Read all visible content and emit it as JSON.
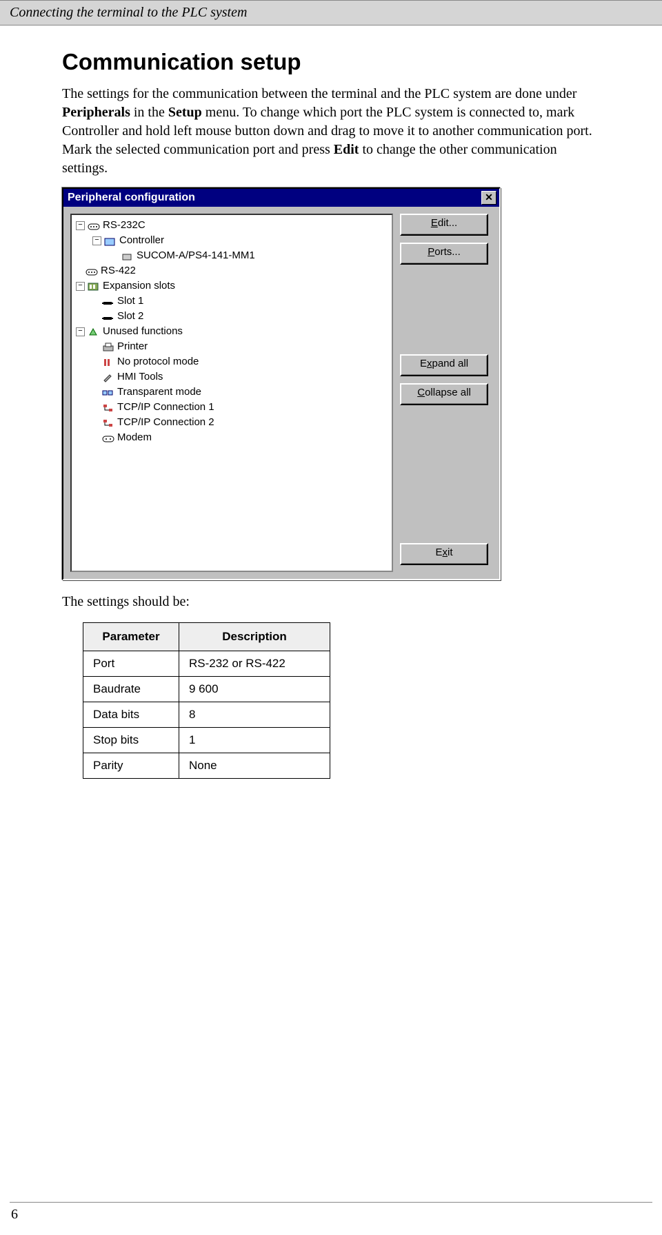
{
  "header": {
    "title": "Connecting the terminal to the PLC system"
  },
  "main": {
    "heading": "Communication setup",
    "para1_a": "The settings for the communication between the terminal and the PLC system are done under ",
    "para1_b": "Peripherals",
    "para1_c": " in the ",
    "para1_d": "Setup",
    "para1_e": " menu. To change which port the PLC system is connected to, mark Controller and hold left mouse button down and drag to move it to another communication port. Mark the selected communication port and press ",
    "para1_f": "Edit",
    "para1_g": " to change the other communication settings.",
    "after_dialog": "The settings should be:"
  },
  "dialog": {
    "title": "Peripheral configuration",
    "buttons": {
      "edit": "Edit...",
      "ports": "Ports...",
      "expand": "Expand all",
      "collapse": "Collapse all",
      "exit": "Exit"
    },
    "tree": {
      "rs232c": "RS-232C",
      "controller": "Controller",
      "driver": "SUCOM-A/PS4-141-MM1",
      "rs422": "RS-422",
      "expansion": "Expansion slots",
      "slot1": "Slot 1",
      "slot2": "Slot 2",
      "unused": "Unused functions",
      "printer": "Printer",
      "noproto": "No protocol mode",
      "hmi": "HMI Tools",
      "transparent": "Transparent mode",
      "tcpip1": "TCP/IP Connection 1",
      "tcpip2": "TCP/IP Connection 2",
      "modem": "Modem"
    }
  },
  "table": {
    "h1": "Parameter",
    "h2": "Description",
    "rows": [
      {
        "p": "Port",
        "d": "RS-232 or RS-422"
      },
      {
        "p": "Baudrate",
        "d": "9 600"
      },
      {
        "p": "Data bits",
        "d": "8"
      },
      {
        "p": "Stop bits",
        "d": "1"
      },
      {
        "p": "Parity",
        "d": "None"
      }
    ]
  },
  "footer": {
    "page": "6"
  }
}
